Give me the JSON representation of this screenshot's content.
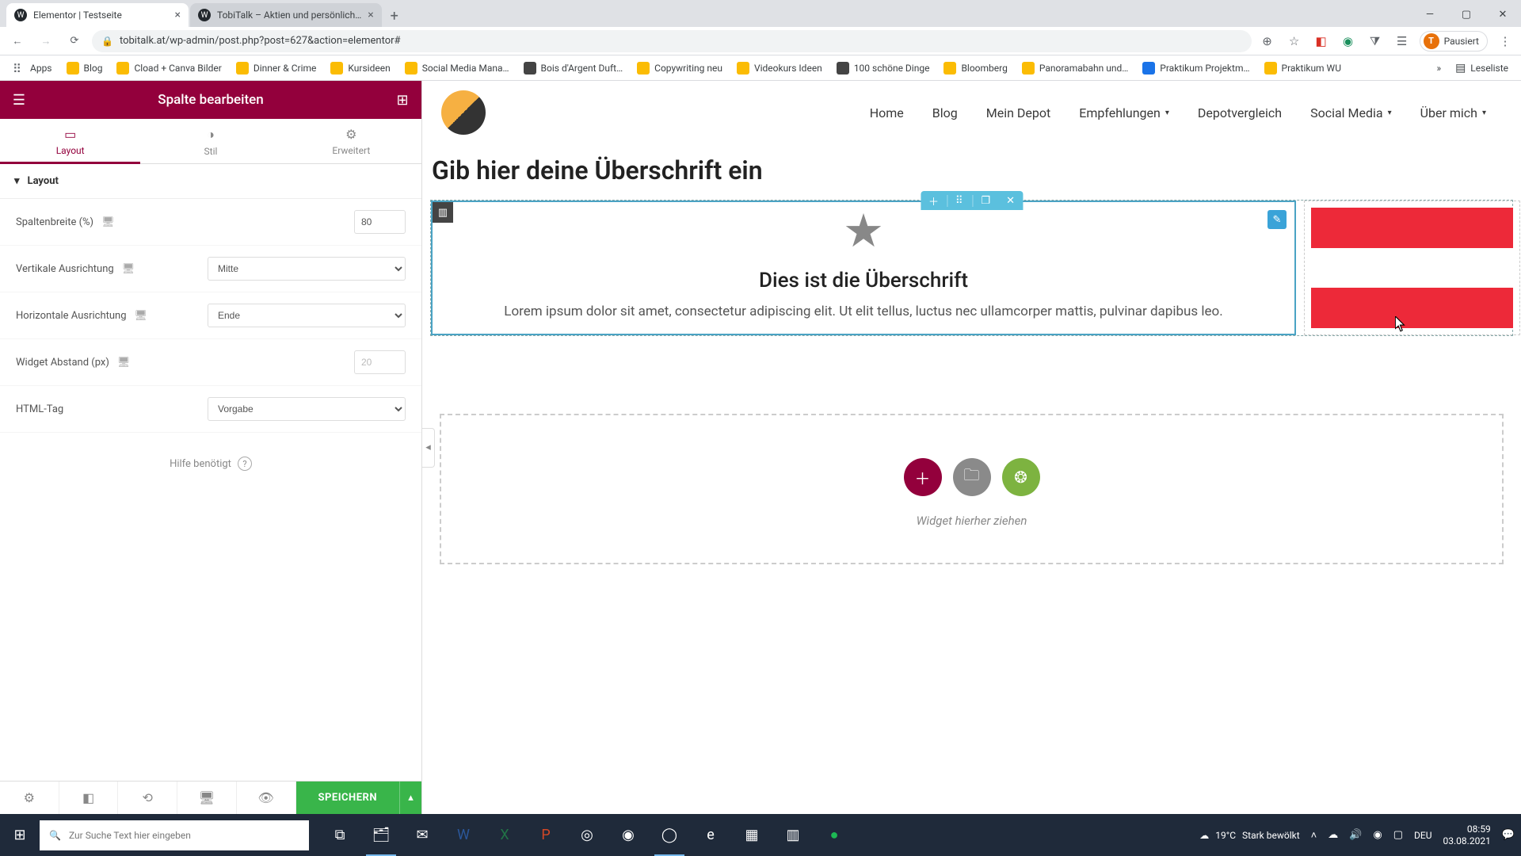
{
  "chrome": {
    "tabs": [
      {
        "favicon_bg": "#23282d",
        "favicon_fg": "#fff",
        "favicon_txt": "W",
        "title": "Elementor | Testseite"
      },
      {
        "favicon_bg": "#23282d",
        "favicon_fg": "#fff",
        "favicon_txt": "W",
        "title": "TobiTalk – Aktien und persönlich…"
      }
    ],
    "url": "tobitalk.at/wp-admin/post.php?post=627&action=elementor#",
    "paused": "Pausiert",
    "avatar_initial": "T",
    "bookmarks": [
      {
        "label": "Apps",
        "cls": "apps"
      },
      {
        "label": "Blog",
        "cls": ""
      },
      {
        "label": "Cload + Canva Bilder",
        "cls": ""
      },
      {
        "label": "Dinner & Crime",
        "cls": ""
      },
      {
        "label": "Kursideen",
        "cls": ""
      },
      {
        "label": "Social Media Mana…",
        "cls": ""
      },
      {
        "label": "Bois d'Argent Duft…",
        "cls": "dark"
      },
      {
        "label": "Copywriting neu",
        "cls": ""
      },
      {
        "label": "Videokurs Ideen",
        "cls": ""
      },
      {
        "label": "100 schöne Dinge",
        "cls": "dark"
      },
      {
        "label": "Bloomberg",
        "cls": ""
      },
      {
        "label": "Panoramabahn und…",
        "cls": ""
      },
      {
        "label": "Praktikum Projektm…",
        "cls": "blue"
      },
      {
        "label": "Praktikum WU",
        "cls": ""
      }
    ],
    "readlist": "Leseliste"
  },
  "panel": {
    "title": "Spalte bearbeiten",
    "tabs": {
      "layout": "Layout",
      "style": "Stil",
      "advanced": "Erweitert"
    },
    "section": "Layout",
    "controls": {
      "col_width_label": "Spaltenbreite (%)",
      "col_width_value": "80",
      "valign_label": "Vertikale Ausrichtung",
      "valign_value": "Mitte",
      "halign_label": "Horizontale Ausrichtung",
      "halign_value": "Ende",
      "widget_space_label": "Widget Abstand (px)",
      "widget_space_placeholder": "20",
      "html_tag_label": "HTML-Tag",
      "html_tag_value": "Vorgabe"
    },
    "help": "Hilfe benötigt",
    "save": "SPEICHERN"
  },
  "site": {
    "nav": {
      "home": "Home",
      "blog": "Blog",
      "depot": "Mein Depot",
      "empf": "Empfehlungen",
      "vergleich": "Depotvergleich",
      "social": "Social Media",
      "about": "Über mich"
    },
    "page_title": "Gib hier deine Überschrift ein",
    "iconbox": {
      "heading": "Dies ist die Überschrift",
      "text": "Lorem ipsum dolor sit amet, consectetur adipiscing elit. Ut elit tellus, luctus nec ullamcorper mattis, pulvinar dapibus leo."
    },
    "dropzone": "Widget hierher ziehen"
  },
  "taskbar": {
    "search_placeholder": "Zur Suche Text hier eingeben",
    "weather_temp": "19°C",
    "weather_desc": "Stark bewölkt",
    "lang": "DEU",
    "time": "08:59",
    "date": "03.08.2021"
  }
}
